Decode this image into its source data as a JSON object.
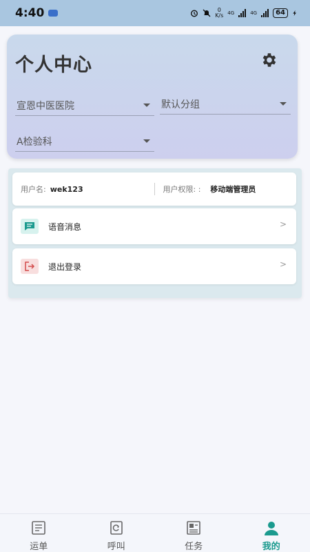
{
  "status_bar": {
    "time": "4:40",
    "net_speed_top": "0",
    "net_speed_unit": "K/s",
    "network_1": "4G",
    "network_2": "4G",
    "battery": "64"
  },
  "header": {
    "title": "个人中心",
    "hospital_select": "宣恩中医医院",
    "group_select": "默认分组",
    "department_select": "A检验科"
  },
  "user_info": {
    "username_label": "用户名:",
    "username_value": "wek123",
    "permission_label": "用户权限: :",
    "permission_value": "移动端管理员"
  },
  "menu": {
    "voice_message": "语音消息",
    "logout": "退出登录",
    "arrow": ">"
  },
  "nav": {
    "items": [
      {
        "label": "运单"
      },
      {
        "label": "呼叫"
      },
      {
        "label": "任务"
      },
      {
        "label": "我的"
      }
    ]
  },
  "colors": {
    "accent": "#1a9a8e",
    "header_gradient_top": "#c9d9ec",
    "header_gradient_bottom": "#cdcfee",
    "voice_icon_bg": "#d7f2ee",
    "logout_icon_bg": "#f8dede"
  }
}
